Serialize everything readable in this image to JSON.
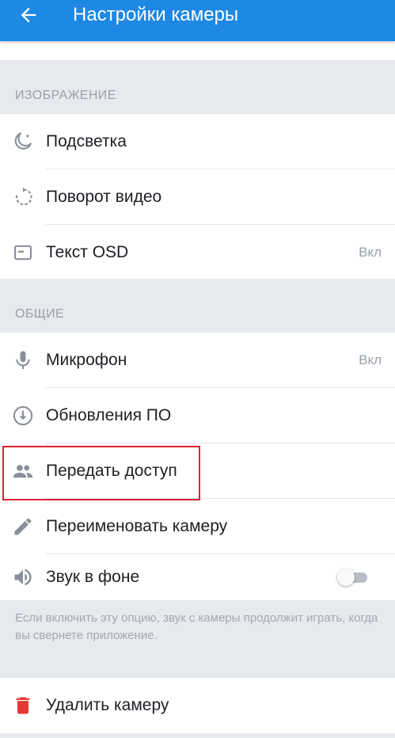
{
  "appbar": {
    "title": "Настройки камеры",
    "back_icon": "arrow-back-icon"
  },
  "sections": {
    "image": "ИЗОБРАЖЕНИЕ",
    "general": "ОБЩИЕ"
  },
  "rows": {
    "backlight": {
      "label": "Подсветка",
      "icon": "night-mode-icon"
    },
    "rotate": {
      "label": "Поворот видео",
      "icon": "rotate-icon"
    },
    "osd": {
      "label": "Текст OSD",
      "value": "Вкл",
      "icon": "text-osd-icon"
    },
    "mic": {
      "label": "Микрофон",
      "value": "Вкл",
      "icon": "microphone-icon"
    },
    "firmware": {
      "label": "Обновления ПО",
      "icon": "download-circle-icon"
    },
    "share": {
      "label": "Передать доступ",
      "icon": "people-icon"
    },
    "rename": {
      "label": "Переименовать камеру",
      "icon": "pencil-icon"
    },
    "bg_sound": {
      "label": "Звук в фоне",
      "toggle_on": false,
      "icon": "speaker-icon"
    },
    "delete": {
      "label": "Удалить камеру",
      "icon": "trash-icon"
    }
  },
  "bg_sound_hint": "Если включить эту опцию, звук с камеры продолжит играть, когда вы свернете приложение.",
  "colors": {
    "primary": "#1e88e5",
    "danger": "#e53935",
    "highlight": "#d9232e"
  }
}
